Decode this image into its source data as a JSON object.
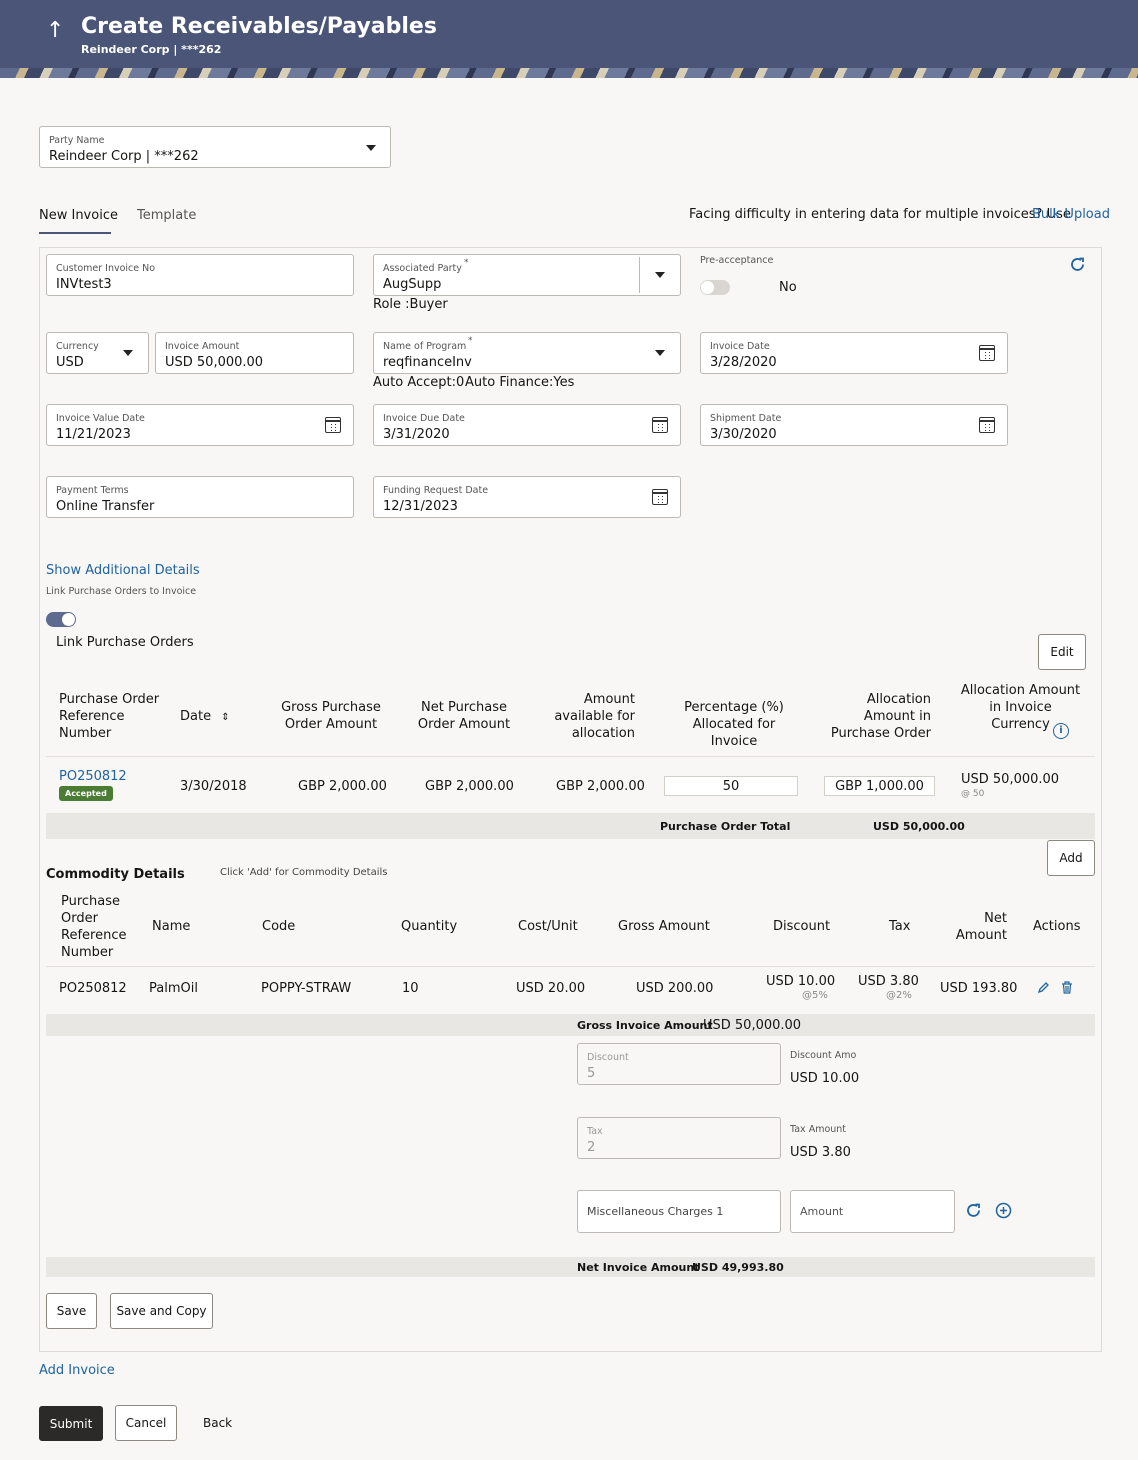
{
  "header": {
    "back_icon": "up-arrow-icon",
    "title": "Create Receivables/Payables",
    "subtitle": "Reindeer Corp | ***262"
  },
  "party": {
    "label": "Party Name",
    "value": "Reindeer Corp | ***262"
  },
  "tabs": [
    {
      "label": "New Invoice"
    },
    {
      "label": "Template"
    }
  ],
  "bulk": {
    "text": "Facing difficulty in entering data for multiple invoices? Use",
    "link": "Bulk Upload"
  },
  "form": {
    "customer_invoice_no": {
      "label": "Customer Invoice No",
      "value": "INVtest3"
    },
    "associated_party": {
      "label": "Associated Party",
      "required": "*",
      "value": "AugSupp",
      "role": "Role :Buyer"
    },
    "pre_acceptance": {
      "label": "Pre-acceptance",
      "value": "No"
    },
    "currency": {
      "label": "Currency",
      "value": "USD"
    },
    "invoice_amount": {
      "label": "Invoice Amount",
      "value": "USD 50,000.00"
    },
    "program": {
      "label": "Name of Program",
      "required": "*",
      "value": "reqfinanceInv",
      "auto_accept": "Auto Accept:0",
      "auto_finance": "Auto Finance:Yes"
    },
    "invoice_date": {
      "label": "Invoice Date",
      "value": "3/28/2020"
    },
    "invoice_value_date": {
      "label": "Invoice Value Date",
      "value": "11/21/2023"
    },
    "invoice_due_date": {
      "label": "Invoice Due Date",
      "value": "3/31/2020"
    },
    "shipment_date": {
      "label": "Shipment Date",
      "value": "3/30/2020"
    },
    "payment_terms": {
      "label": "Payment Terms",
      "value": "Online Transfer"
    },
    "funding_request_date": {
      "label": "Funding Request Date",
      "value": "12/31/2023"
    }
  },
  "additional": {
    "show_link": "Show Additional Details",
    "link_po_label": "Link Purchase Orders to Invoice",
    "link_po_toggle": "Link Purchase Orders",
    "edit": "Edit"
  },
  "po_table": {
    "headers": [
      "Purchase Order Reference Number",
      "Date",
      "Gross Purchase Order Amount",
      "Net Purchase Order Amount",
      "Amount available for allocation",
      "Percentage (%) Allocated for Invoice",
      "Allocation Amount in Purchase Order",
      "Allocation Amount in Invoice Currency"
    ],
    "row": {
      "ref": "PO250812",
      "status": "Accepted",
      "date": "3/30/2018",
      "gross": "GBP 2,000.00",
      "net": "GBP 2,000.00",
      "available": "GBP 2,000.00",
      "percentage": "50",
      "alloc_po": "GBP 1,000.00",
      "alloc_inv": "USD 50,000.00",
      "alloc_inv_sub": "@ 50"
    },
    "total_label": "Purchase Order Total",
    "total_value": "USD 50,000.00"
  },
  "commodity": {
    "title": "Commodity Details",
    "hint": "Click 'Add' for Commodity Details",
    "add": "Add",
    "headers": [
      "Purchase Order Reference Number",
      "Name",
      "Code",
      "Quantity",
      "Cost/Unit",
      "Gross Amount",
      "Discount",
      "Tax",
      "Net Amount",
      "Actions"
    ],
    "row": {
      "ref": "PO250812",
      "name": "PalmOil",
      "code": "POPPY-STRAW",
      "qty": "10",
      "cost": "USD 20.00",
      "gross": "USD 200.00",
      "discount": "USD 10.00",
      "discount_sub": "@5%",
      "tax": "USD 3.80",
      "tax_sub": "@2%",
      "net": "USD 193.80"
    }
  },
  "summary": {
    "gross_label": "Gross Invoice Amount",
    "gross_value": "USD 50,000.00",
    "discount_label": "Discount",
    "discount_value": "5",
    "discount_amt_label": "Discount Amo",
    "discount_amt_value": "USD 10.00",
    "tax_label": "Tax",
    "tax_value": "2",
    "tax_amt_label": "Tax Amount",
    "tax_amt_value": "USD 3.80",
    "misc_label": "Miscellaneous Charges 1",
    "amount_placeholder": "Amount",
    "net_label": "Net Invoice Amount",
    "net_value": "USD 49,993.80"
  },
  "buttons": {
    "save": "Save",
    "save_copy": "Save and Copy",
    "add_invoice": "Add Invoice",
    "submit": "Submit",
    "cancel": "Cancel",
    "back": "Back"
  },
  "colors": {
    "header": "#4a5578",
    "link": "#1f63a0",
    "accepted": "#4b7c33",
    "submit": "#2b2a28"
  }
}
